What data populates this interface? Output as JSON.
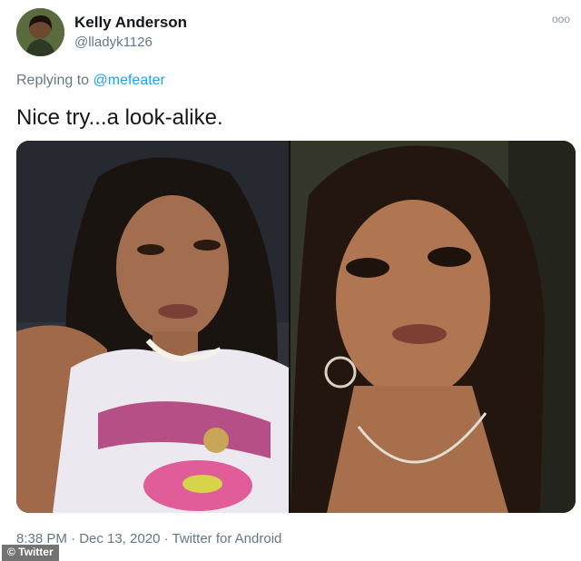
{
  "tweet": {
    "author_name": "Kelly Anderson",
    "author_handle": "@lladyk1126",
    "more_glyph": "ooo",
    "reply_prefix": "Replying to",
    "reply_mention": "@mefeater",
    "text": "Nice try...a look-alike.",
    "meta": "8:38 PM · Dec 13, 2020 · Twitter for Android"
  },
  "watermark": {
    "label": "© Twitter"
  },
  "colors": {
    "link": "#1da1f2",
    "secondary_text": "#657786",
    "primary_text": "#14171a"
  },
  "icons": {
    "more": "more-options-icon",
    "avatar": "profile-avatar"
  }
}
